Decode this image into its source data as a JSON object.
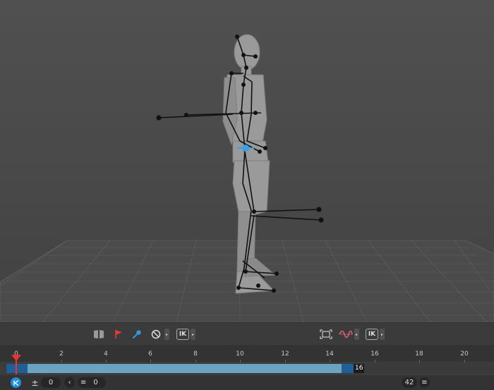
{
  "toolbar": {
    "ik_left_label": "IK",
    "ik_right_label": "IK"
  },
  "timeline": {
    "ticks": [
      "0",
      "2",
      "4",
      "6",
      "8",
      "10",
      "12",
      "14",
      "16",
      "18",
      "20"
    ],
    "range_end_label": "16",
    "current_frame": "0",
    "offset_value": "0",
    "total_frames": "42"
  },
  "colors": {
    "accent_blue": "#1f5f96",
    "range_fill": "#6aa4c0",
    "playhead": "#e33333",
    "flag": "#e53935",
    "key_icon": "#2f9be0",
    "curve_icon": "#e0607a"
  },
  "icons": {
    "book": "book-icon",
    "flag": "flag-icon",
    "key": "key-icon",
    "no": "no-entry-icon",
    "frame": "frame-selection-icon",
    "curve": "motion-curve-icon",
    "start": "go-to-start-icon"
  }
}
